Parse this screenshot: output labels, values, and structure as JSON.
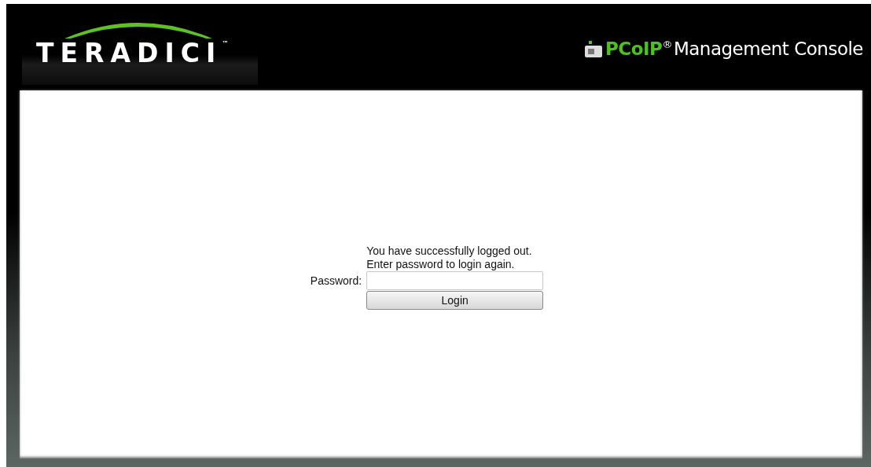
{
  "header": {
    "logo": "TERADICI$^{™}$",
    "product_title": "**PCoIP**$^{®}$Management Console"
  },
  "login": {
    "messages": [
      "You have successfully logged out.",
      "Enter password to login again."
    ],
    "password_label": "Password:",
    "button": "Login"
  }
}
